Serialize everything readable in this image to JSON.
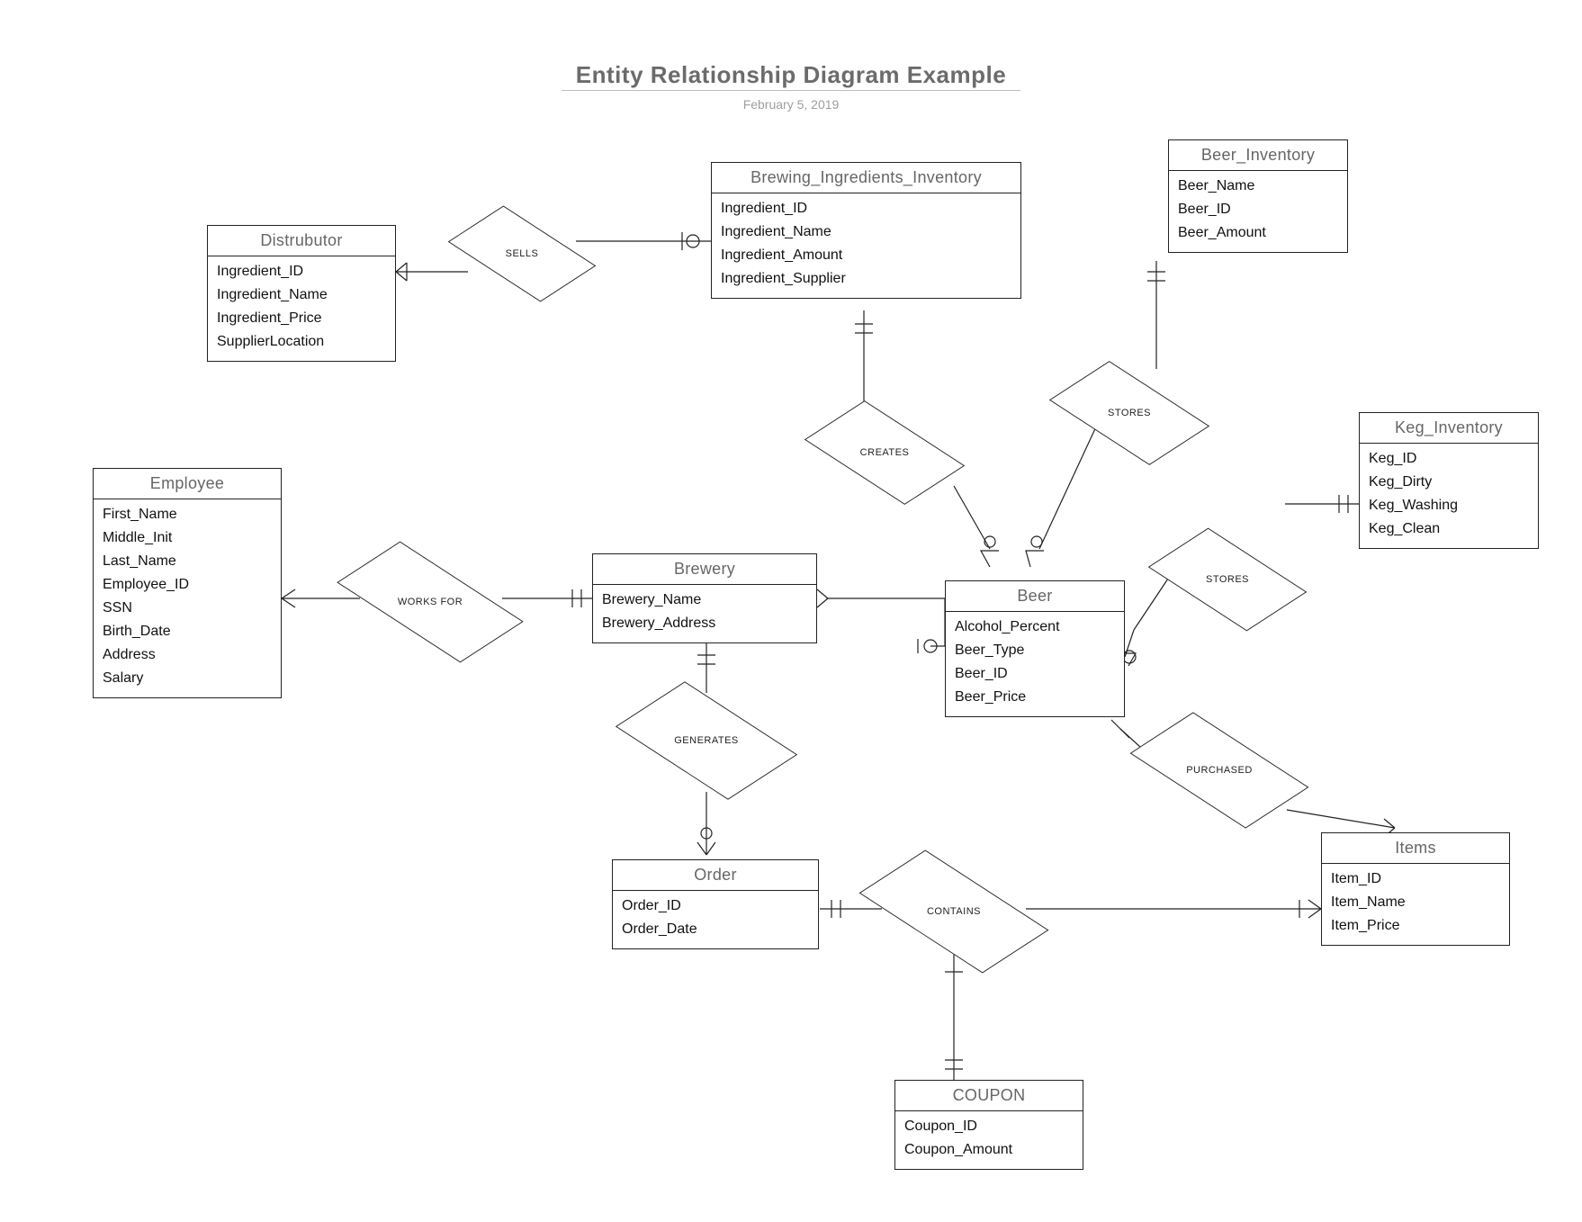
{
  "title": "Entity Relationship Diagram Example",
  "date": "February 5, 2019",
  "entities": {
    "distributor": {
      "name": "Distrubutor",
      "attrs": [
        "Ingredient_ID",
        "Ingredient_Name",
        "Ingredient_Price",
        "SupplierLocation"
      ]
    },
    "brewing_ingredients": {
      "name": "Brewing_Ingredients_Inventory",
      "attrs": [
        "Ingredient_ID",
        "Ingredient_Name",
        "Ingredient_Amount",
        "Ingredient_Supplier"
      ]
    },
    "beer_inventory": {
      "name": "Beer_Inventory",
      "attrs": [
        "Beer_Name",
        "Beer_ID",
        "Beer_Amount"
      ]
    },
    "keg_inventory": {
      "name": "Keg_Inventory",
      "attrs": [
        "Keg_ID",
        "Keg_Dirty",
        "Keg_Washing",
        "Keg_Clean"
      ]
    },
    "employee": {
      "name": "Employee",
      "attrs": [
        "First_Name",
        "Middle_Init",
        "Last_Name",
        "Employee_ID",
        "SSN",
        "Birth_Date",
        "Address",
        "Salary"
      ]
    },
    "brewery": {
      "name": "Brewery",
      "attrs": [
        "Brewery_Name",
        "Brewery_Address"
      ]
    },
    "beer": {
      "name": "Beer",
      "attrs": [
        "Alcohol_Percent",
        "Beer_Type",
        "Beer_ID",
        "Beer_Price"
      ]
    },
    "order": {
      "name": "Order",
      "attrs": [
        "Order_ID",
        "Order_Date"
      ]
    },
    "items": {
      "name": "Items",
      "attrs": [
        "Item_ID",
        "Item_Name",
        "Item_Price"
      ]
    },
    "coupon": {
      "name": "COUPON",
      "attrs": [
        "Coupon_ID",
        "Coupon_Amount"
      ]
    }
  },
  "relationships": {
    "sells": "SELLS",
    "creates": "CREATES",
    "stores1": "STORES",
    "stores2": "STORES",
    "works_for": "WORKS FOR",
    "generates": "GENERATES",
    "purchased": "PURCHASED",
    "contains": "CONTAINS"
  }
}
